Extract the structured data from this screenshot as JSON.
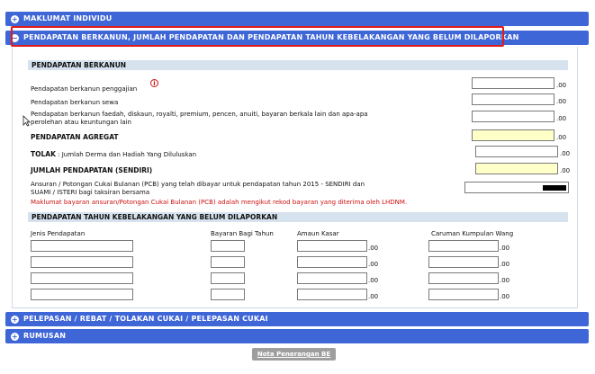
{
  "sections": {
    "maklumat": "MAKLUMAT INDIVIDU",
    "pendapatan": "PENDAPATAN BERKANUN, JUMLAH PENDAPATAN DAN PENDAPATAN TAHUN KEBELAKANGAN YANG BELUM DILAPORKAN",
    "pelepasan": "PELEPASAN / REBAT / TOLAKAN CUKAI / PELEPASAN CUKAI",
    "rumusan": "RUMUSAN"
  },
  "berkanun": {
    "header": "PENDAPATAN BERKANUN",
    "penggajian": "Pendapatan berkanun penggajian",
    "sewa": "Pendapatan berkanun sewa",
    "faedah_line1": "Pendapatan berkanun faedah, diskaun, royalti, premium, pencen, anuiti, bayaran berkala lain dan apa-apa",
    "faedah_line2": "perolehan atau keuntungan lain",
    "agregat": "PENDAPATAN AGREGAT",
    "tolak": "TOLAK",
    "tolak_desc": ": Jumlah Derma dan Hadiah Yang Diluluskan",
    "jumlah": "JUMLAH PENDAPATAN (SENDIRI)",
    "pcb_line1": "Ansuran / Potongan Cukai Bulanan (PCB) yang telah dibayar untuk pendapatan tahun 2015 - SENDIRI dan",
    "pcb_line2": "SUAMI / ISTERI bagi taksiran bersama",
    "pcb_note": "Maklumat bayaran ansuran/Potongan Cukai Bulanan (PCB) adalah mengikut rekod bayaran yang diterima oleh LHDNM.",
    "decimal": ".00"
  },
  "kebelakangan": {
    "header": "PENDAPATAN TAHUN KEBELAKANGAN YANG BELUM DILAPORKAN",
    "col_jenis": "Jenis Pendapatan",
    "col_bayaran": "Bayaran Bagi Tahun",
    "col_amaun": "Amaun Kasar",
    "col_caruman": "Caruman Kumpulan Wang",
    "decimal": ".00"
  },
  "button": {
    "nota": "Nota Penerangan BE"
  },
  "icons": {
    "expand": "plus-icon",
    "collapse": "minus-icon",
    "info": "info-icon",
    "cursor": "mouse-cursor-icon"
  },
  "colors": {
    "section_bar": "#3f66d6",
    "highlight": "#e01b1b",
    "sub_header": "#d6e2ee",
    "required_field": "#ffffc8"
  }
}
